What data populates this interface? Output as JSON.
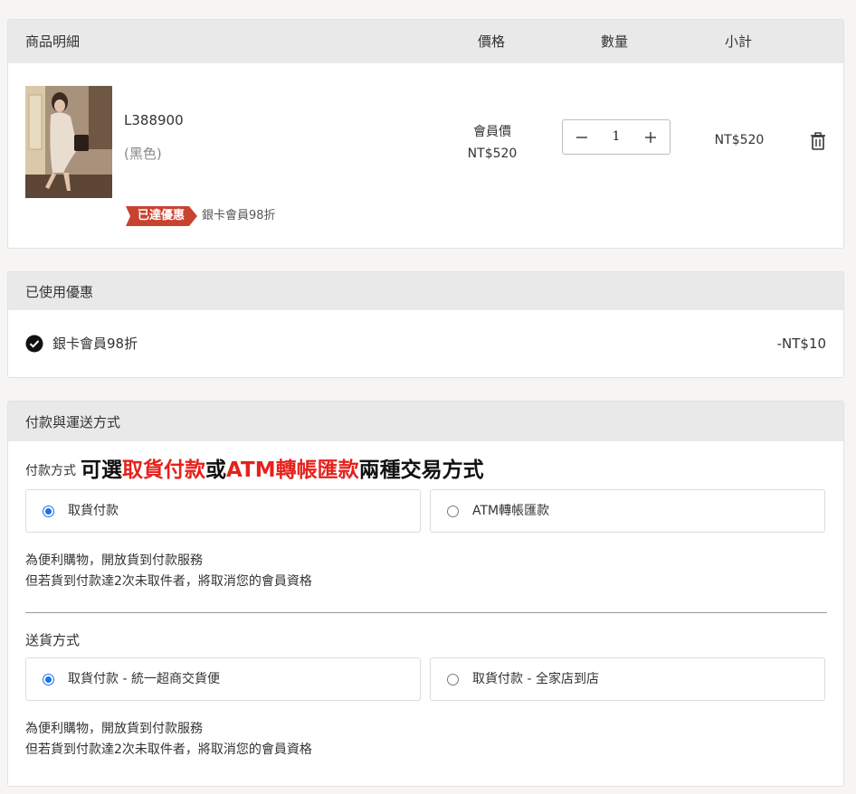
{
  "items_table": {
    "headers": {
      "details": "商品明細",
      "price": "價格",
      "quantity": "數量",
      "subtotal": "小計"
    },
    "rows": [
      {
        "sku": "L388900",
        "variant": "(黑色)",
        "price_label": "會員價",
        "price": "NT$520",
        "quantity": "1",
        "subtotal": "NT$520",
        "promo_tag": "已達優惠",
        "promo_desc": "銀卡會員98折"
      }
    ]
  },
  "used_discounts": {
    "title": "已使用優惠",
    "items": [
      {
        "label": "銀卡會員98折",
        "amount": "-NT$10"
      }
    ]
  },
  "payment_shipping": {
    "title": "付款與運送方式",
    "payment_label": "付款方式",
    "headline": {
      "part1": "可選",
      "part2": "取貨付款",
      "part3": "或",
      "part4": "ATM轉帳匯款",
      "part5": "兩種交易方式"
    },
    "payment_options": [
      {
        "label": "取貨付款",
        "selected": true
      },
      {
        "label": "ATM轉帳匯款",
        "selected": false
      }
    ],
    "payment_note": [
      "為便利購物，開放貨到付款服務",
      "但若貨到付款達2次未取件者，將取消您的會員資格"
    ],
    "shipping_label": "送貨方式",
    "shipping_options": [
      {
        "label": "取貨付款 - 統一超商交貨便",
        "selected": true
      },
      {
        "label": "取貨付款 - 全家店到店",
        "selected": false
      }
    ],
    "shipping_note": [
      "為便利購物，開放貨到付款服務",
      "但若貨到付款達2次未取件者，將取消您的會員資格"
    ]
  },
  "colors": {
    "accent_red": "#e6211c",
    "promo_tag": "#c8432f",
    "radio_selected": "#1a73e8",
    "header_bg": "#e9e9e9"
  },
  "icons": {
    "minus": "minus-icon",
    "plus": "plus-icon",
    "trash": "trash-icon",
    "check": "check-circle-icon"
  }
}
